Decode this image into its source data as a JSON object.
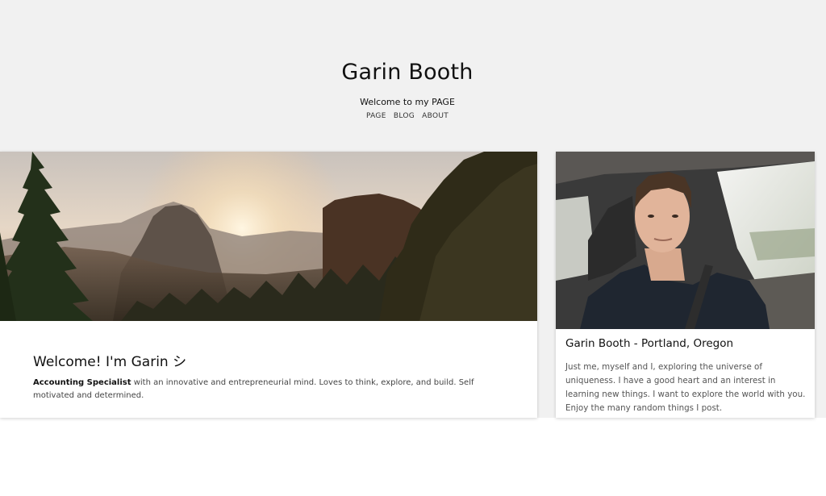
{
  "header": {
    "title": "Garin Booth",
    "tagline": "Welcome to my PAGE",
    "nav": [
      "PAGE",
      "BLOG",
      "ABOUT"
    ]
  },
  "main": {
    "heading": "Welcome! I'm Garin シ",
    "bio_strong": "Accounting Specialist",
    "bio_rest": " with an innovative and entrepreneurial mind. Loves to think, explore, and build. Self motivated and determined."
  },
  "side": {
    "heading": "Garin Booth - Portland, Oregon",
    "text": "Just me, myself and I, exploring the universe of uniqueness. I have a good heart and an interest in learning new things. I want to explore the world with you. Enjoy the many random things I post."
  },
  "colors": {
    "page_bg": "#f1f1f1",
    "card_bg": "#ffffff"
  }
}
